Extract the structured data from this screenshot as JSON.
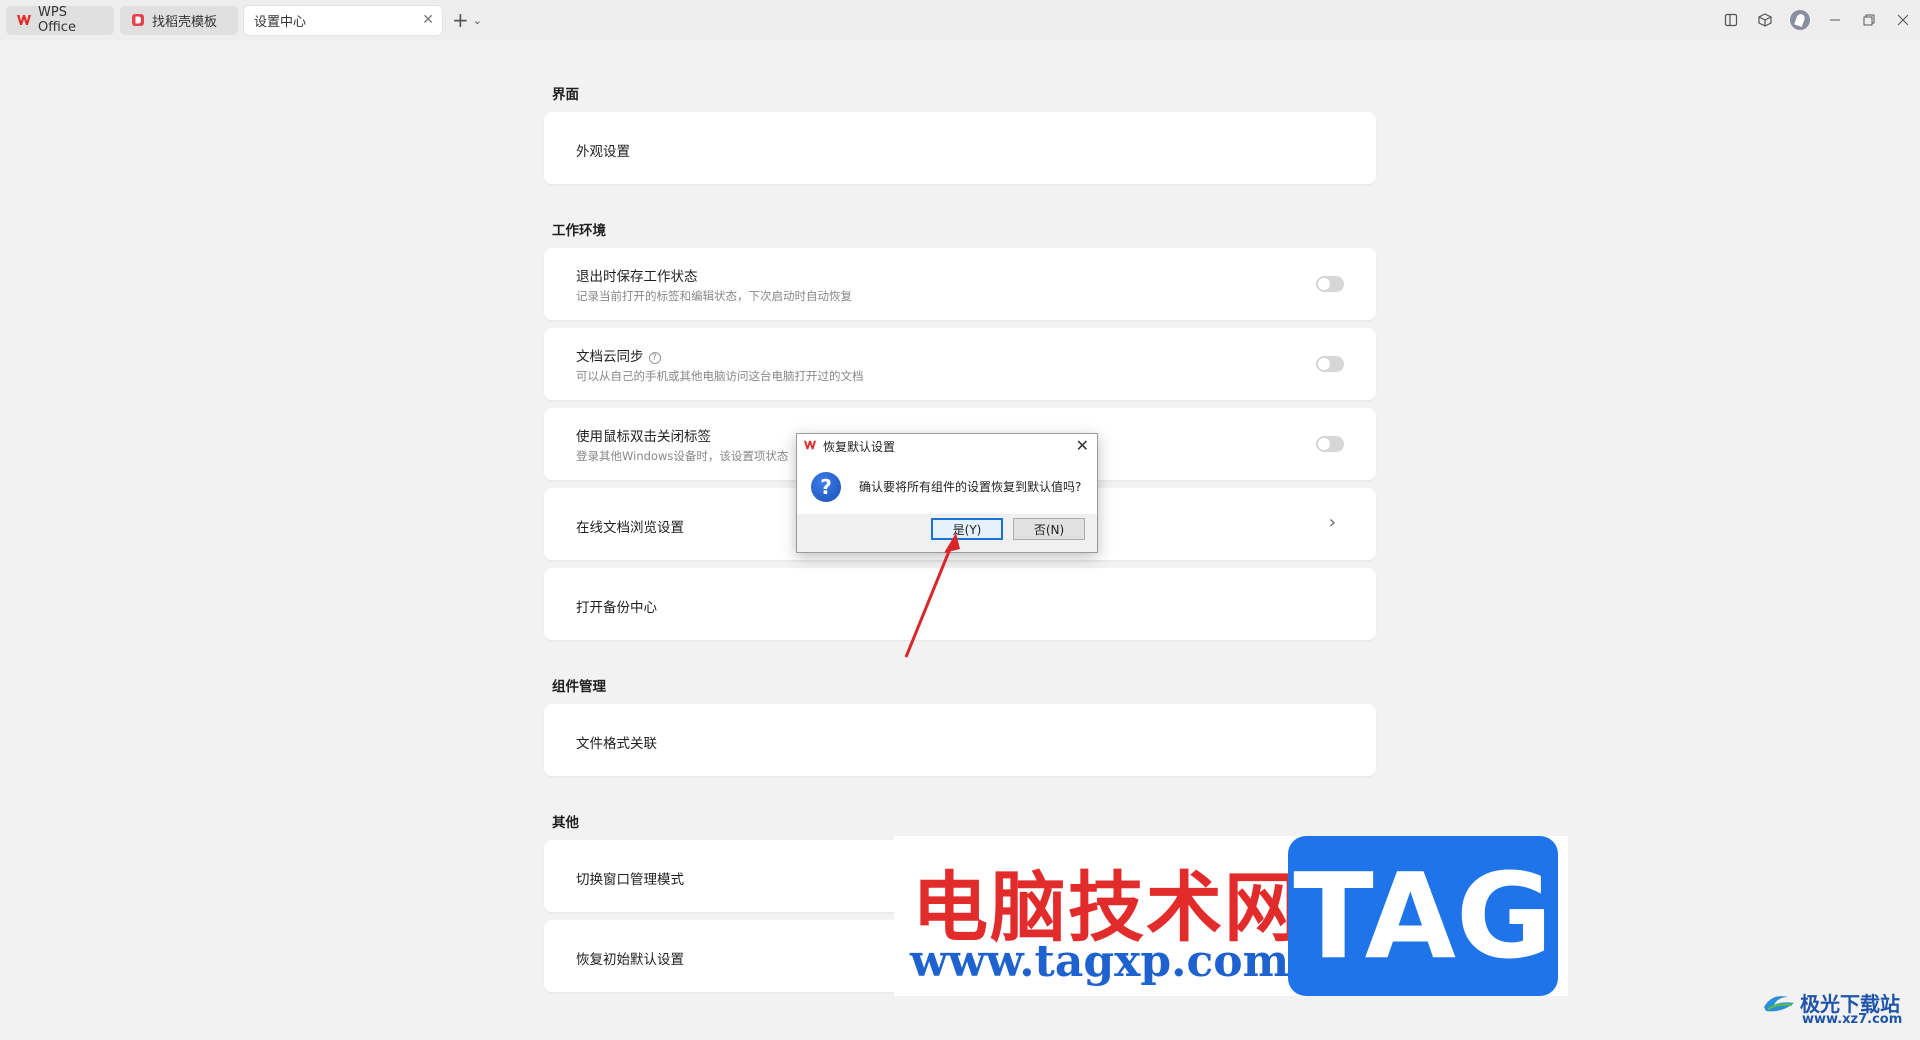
{
  "titlebar": {
    "tabs": [
      {
        "label": "WPS Office"
      },
      {
        "label": "找稻壳模板"
      },
      {
        "label": "设置中心"
      }
    ],
    "new_tab": "+",
    "new_tab_menu": "⌄"
  },
  "sections": {
    "interface": {
      "title": "界面",
      "appearance": "外观设置"
    },
    "workspace": {
      "title": "工作环境",
      "save_state": {
        "label": "退出时保存工作状态",
        "desc": "记录当前打开的标签和编辑状态，下次启动时自动恢复"
      },
      "cloud_sync": {
        "label": "文档云同步",
        "desc": "可以从自己的手机或其他电脑访问这台电脑打开过的文档"
      },
      "dblclick_close": {
        "label": "使用鼠标双击关闭标签",
        "desc": "登录其他Windows设备时，该设置项状态"
      },
      "online_browse": "在线文档浏览设置",
      "backup_center": "打开备份中心"
    },
    "components": {
      "title": "组件管理",
      "file_assoc": "文件格式关联"
    },
    "other": {
      "title": "其他",
      "switch_window": "切换窗口管理模式",
      "restore_default": "恢复初始默认设置"
    }
  },
  "dialog": {
    "title": "恢复默认设置",
    "message": "确认要将所有组件的设置恢复到默认值吗?",
    "yes": "是(Y)",
    "no": "否(N)"
  },
  "watermark": {
    "cn": "电脑技术网",
    "url": "www.tagxp.com",
    "tag": "TAG",
    "site_cn": "极光下载站",
    "site_url": "www.xz7.com"
  }
}
